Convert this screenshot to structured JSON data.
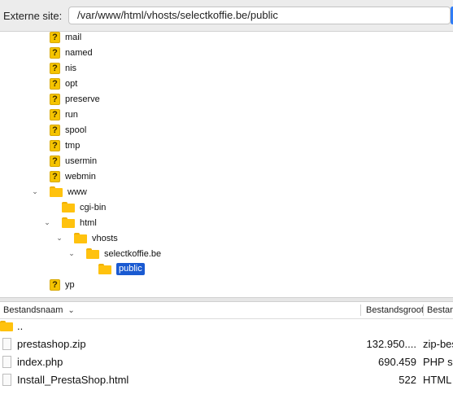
{
  "pathbar": {
    "label": "Externe site:",
    "path": "/var/www/html/vhosts/selectkoffie.be/public"
  },
  "tree": {
    "items": [
      {
        "label": "mail"
      },
      {
        "label": "named"
      },
      {
        "label": "nis"
      },
      {
        "label": "opt"
      },
      {
        "label": "preserve"
      },
      {
        "label": "run"
      },
      {
        "label": "spool"
      },
      {
        "label": "tmp"
      },
      {
        "label": "usermin"
      },
      {
        "label": "webmin"
      },
      {
        "label": "www"
      },
      {
        "label": "cgi-bin"
      },
      {
        "label": "html"
      },
      {
        "label": "vhosts"
      },
      {
        "label": "selectkoffie.be"
      },
      {
        "label": "public"
      },
      {
        "label": "yp"
      }
    ]
  },
  "list": {
    "headers": {
      "name": "Bestandsnaam",
      "size": "Bestandsgrootte",
      "type": "Bestandstype"
    },
    "rows": [
      {
        "name": "..",
        "size": "",
        "type": ""
      },
      {
        "name": "prestashop.zip",
        "size": "132.950....",
        "type": "zip-bestand"
      },
      {
        "name": "index.php",
        "size": "690.459",
        "type": "PHP script"
      },
      {
        "name": "Install_PrestaShop.html",
        "size": "522",
        "type": "HTML"
      }
    ]
  }
}
